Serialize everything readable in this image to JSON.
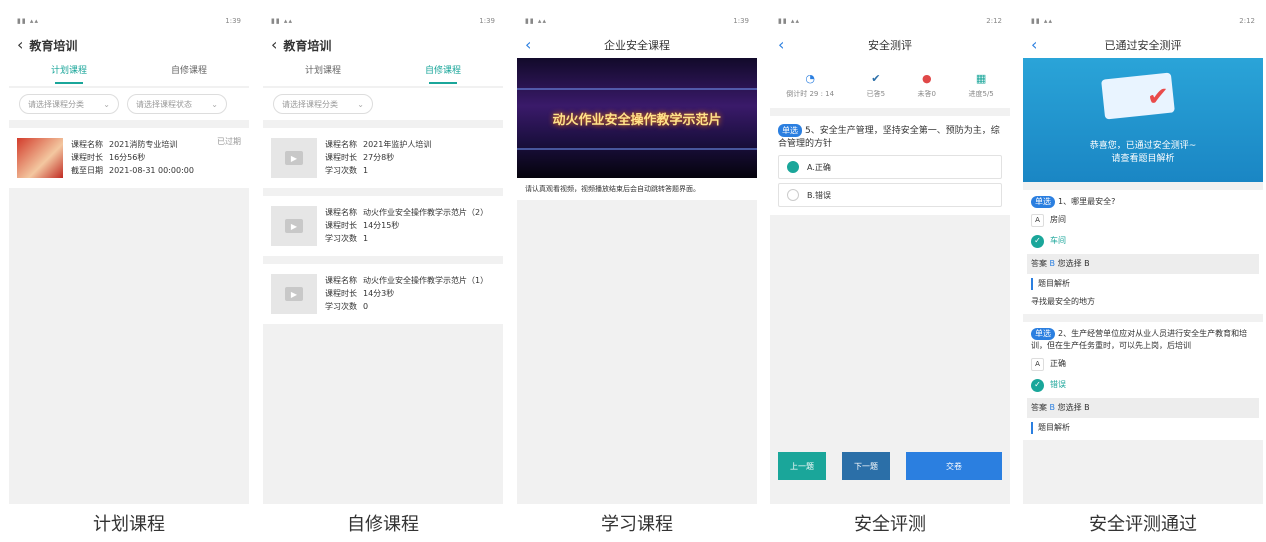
{
  "status_time_1": "1:39",
  "status_time_2": "1:39",
  "status_time_3": "1:39",
  "status_time_4": "2:12",
  "status_time_5": "2:12",
  "s1": {
    "title": "教育培训",
    "tabs": [
      "计划课程",
      "自修课程"
    ],
    "filter_category": "请选择课程分类",
    "filter_status": "请选择课程状态",
    "course": {
      "name_label": "课程名称",
      "name": "2021消防专业培训",
      "duration_label": "课程时长",
      "duration": "16分56秒",
      "deadline_label": "截至日期",
      "deadline": "2021-08-31 00:00:00",
      "status": "已过期"
    },
    "caption": "计划课程"
  },
  "s2": {
    "title": "教育培训",
    "tabs": [
      "计划课程",
      "自修课程"
    ],
    "filter_category": "请选择课程分类",
    "courses": [
      {
        "name_label": "课程名称",
        "name": "2021年监护人培训",
        "duration_label": "课程时长",
        "duration": "27分8秒",
        "count_label": "学习次数",
        "count": "1"
      },
      {
        "name_label": "课程名称",
        "name": "动火作业安全操作教学示范片（2）",
        "duration_label": "课程时长",
        "duration": "14分15秒",
        "count_label": "学习次数",
        "count": "1"
      },
      {
        "name_label": "课程名称",
        "name": "动火作业安全操作教学示范片（1）",
        "duration_label": "课程时长",
        "duration": "14分3秒",
        "count_label": "学习次数",
        "count": "0"
      }
    ],
    "caption": "自修课程"
  },
  "s3": {
    "title": "企业安全课程",
    "video_title": "动火作业安全操作教学示范片",
    "note": "请认真观看视频，视频播放结束后会自动跳转答题界面。",
    "caption": "学习课程"
  },
  "s4": {
    "title": "安全测评",
    "stats": [
      {
        "icon": "clock-icon",
        "text": "倒计时 29 : 14"
      },
      {
        "icon": "check-circle-icon",
        "text": "已答5"
      },
      {
        "icon": "alert-icon",
        "text": "未答0"
      },
      {
        "icon": "grid-icon",
        "text": "进度5/5"
      }
    ],
    "question_type": "单选",
    "question": "5、安全生产管理，坚持安全第一、预防为主，综合管理的方针",
    "options": [
      "A.正确",
      "B.错误"
    ],
    "prev": "上一题",
    "next": "下一题",
    "submit": "交卷",
    "caption": "安全评测"
  },
  "s5": {
    "title": "已通过安全测评",
    "banner_msg_1": "恭喜您，已通过安全测评~",
    "banner_msg_2": "请查看题目解析",
    "q1": {
      "type": "单选",
      "text": "1、哪里最安全?",
      "opt_a_letter": "A",
      "opt_a": "房间",
      "opt_b": "车间",
      "answer_prefix": "答案",
      "answer_key": "B",
      "answer_suffix": "您选择 B",
      "analysis_title": "题目解析",
      "analysis": "寻找最安全的地方"
    },
    "q2": {
      "type": "单选",
      "text": "2、生产经营单位应对从业人员进行安全生产教育和培训，但在生产任务重时，可以先上岗，后培训",
      "opt_a_letter": "A",
      "opt_a": "正确",
      "opt_b": "错误",
      "answer_prefix": "答案",
      "answer_key": "B",
      "answer_suffix": "您选择 B",
      "analysis_title": "题目解析"
    },
    "caption": "安全评测通过"
  }
}
